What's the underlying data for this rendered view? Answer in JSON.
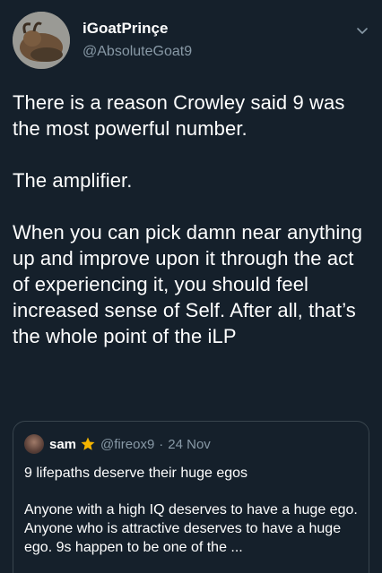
{
  "tweet": {
    "display_name": "iGoatPrinçe",
    "handle": "@AbsoluteGoat9",
    "paragraphs": [
      "There is a reason Crowley said 9 was the most powerful number.",
      "The amplifier.",
      "When you can pick damn near anything up and improve upon it through the act of experiencing it, you should feel increased sense of Self. After all, that’s the whole point of the iLP"
    ]
  },
  "quote": {
    "display_name": "sam",
    "handle": "@fireox9",
    "separator": "·",
    "date": "24 Nov",
    "text_1": "9 lifepaths deserve their huge egos",
    "text_2": "Anyone with a high IQ deserves to have a huge ego. Anyone who is attractive deserves to have a huge ego. 9s happen to be one of the ..."
  },
  "colors": {
    "background": "#15202b",
    "text": "#ffffff",
    "secondary": "#8899a6",
    "border": "#38444d",
    "star": "#f4b400"
  },
  "icons": {
    "chevron": "chevron-down-icon",
    "star": "star-icon"
  }
}
